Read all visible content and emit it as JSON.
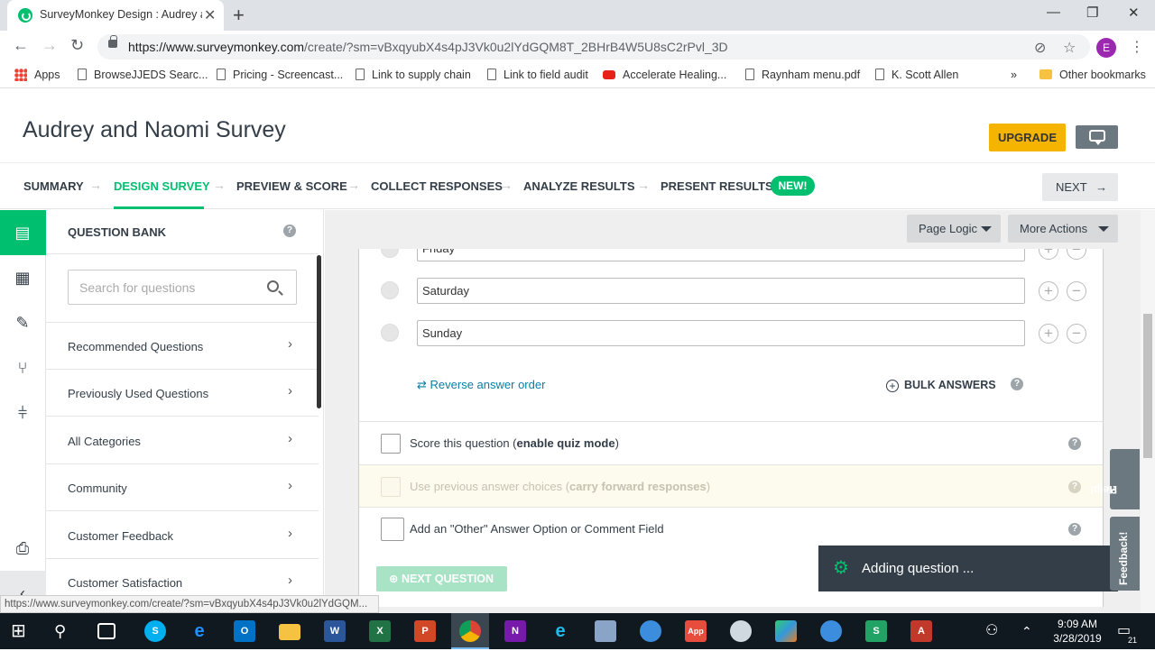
{
  "browser": {
    "tab_title": "SurveyMonkey Design : Audrey a",
    "url_host": "https://www.surveymonkey.com",
    "url_path": "/create/?sm=vBxqyubX4s4pJ3Vk0u2lYdGQM8T_2BHrB4W5U8sC2rPvl_3D",
    "profile_initial": "E",
    "bookmarks": [
      "Apps",
      "BrowseJJEDS Searc...",
      "Pricing - Screencast...",
      "Link to supply chain",
      "Link to field audit",
      "Accelerate Healing...",
      "Raynham menu.pdf",
      "K. Scott Allen"
    ],
    "overflow": "»",
    "other_bookmarks": "Other bookmarks",
    "status_url": "https://www.surveymonkey.com/create/?sm=vBxqyubX4s4pJ3Vk0u2lYdGQM..."
  },
  "page": {
    "survey_title": "Audrey and Naomi Survey",
    "upgrade_label": "UPGRADE",
    "steps": [
      "SUMMARY",
      "DESIGN SURVEY",
      "PREVIEW & SCORE",
      "COLLECT RESPONSES",
      "ANALYZE RESULTS",
      "PRESENT RESULTS"
    ],
    "new_badge": "NEW!",
    "next_label": "NEXT"
  },
  "question_bank": {
    "title": "QUESTION BANK",
    "help": "?",
    "search_placeholder": "Search for questions",
    "categories": [
      "Recommended Questions",
      "Previously Used Questions",
      "All Categories",
      "Community",
      "Customer Feedback",
      "Customer Satisfaction"
    ]
  },
  "editor": {
    "page_logic": "Page Logic",
    "more_actions": "More Actions",
    "answers": [
      "Friday",
      "Saturday",
      "Sunday"
    ],
    "reverse_link": "Reverse answer order",
    "bulk_answers": "BULK ANSWERS",
    "score_option": "Score this question (",
    "score_option_bold": "enable quiz mode",
    "score_option_end": ")",
    "carry_option": "Use previous answer choices (",
    "carry_option_bold": "carry forward responses",
    "carry_option_end": ")",
    "other_option": "Add an \"Other\" Answer Option or Comment Field",
    "next_question": "NEXT QUESTION"
  },
  "toast": {
    "message": "Adding question ..."
  },
  "side_tabs": {
    "help": "Help!",
    "feedback": "Feedback!"
  },
  "taskbar": {
    "time": "9:09 AM",
    "date": "3/28/2019",
    "notifications": "21"
  },
  "colors": {
    "brand_green": "#00bf6f",
    "upgrade_yellow": "#f4b400",
    "dark_slate": "#333e48"
  }
}
